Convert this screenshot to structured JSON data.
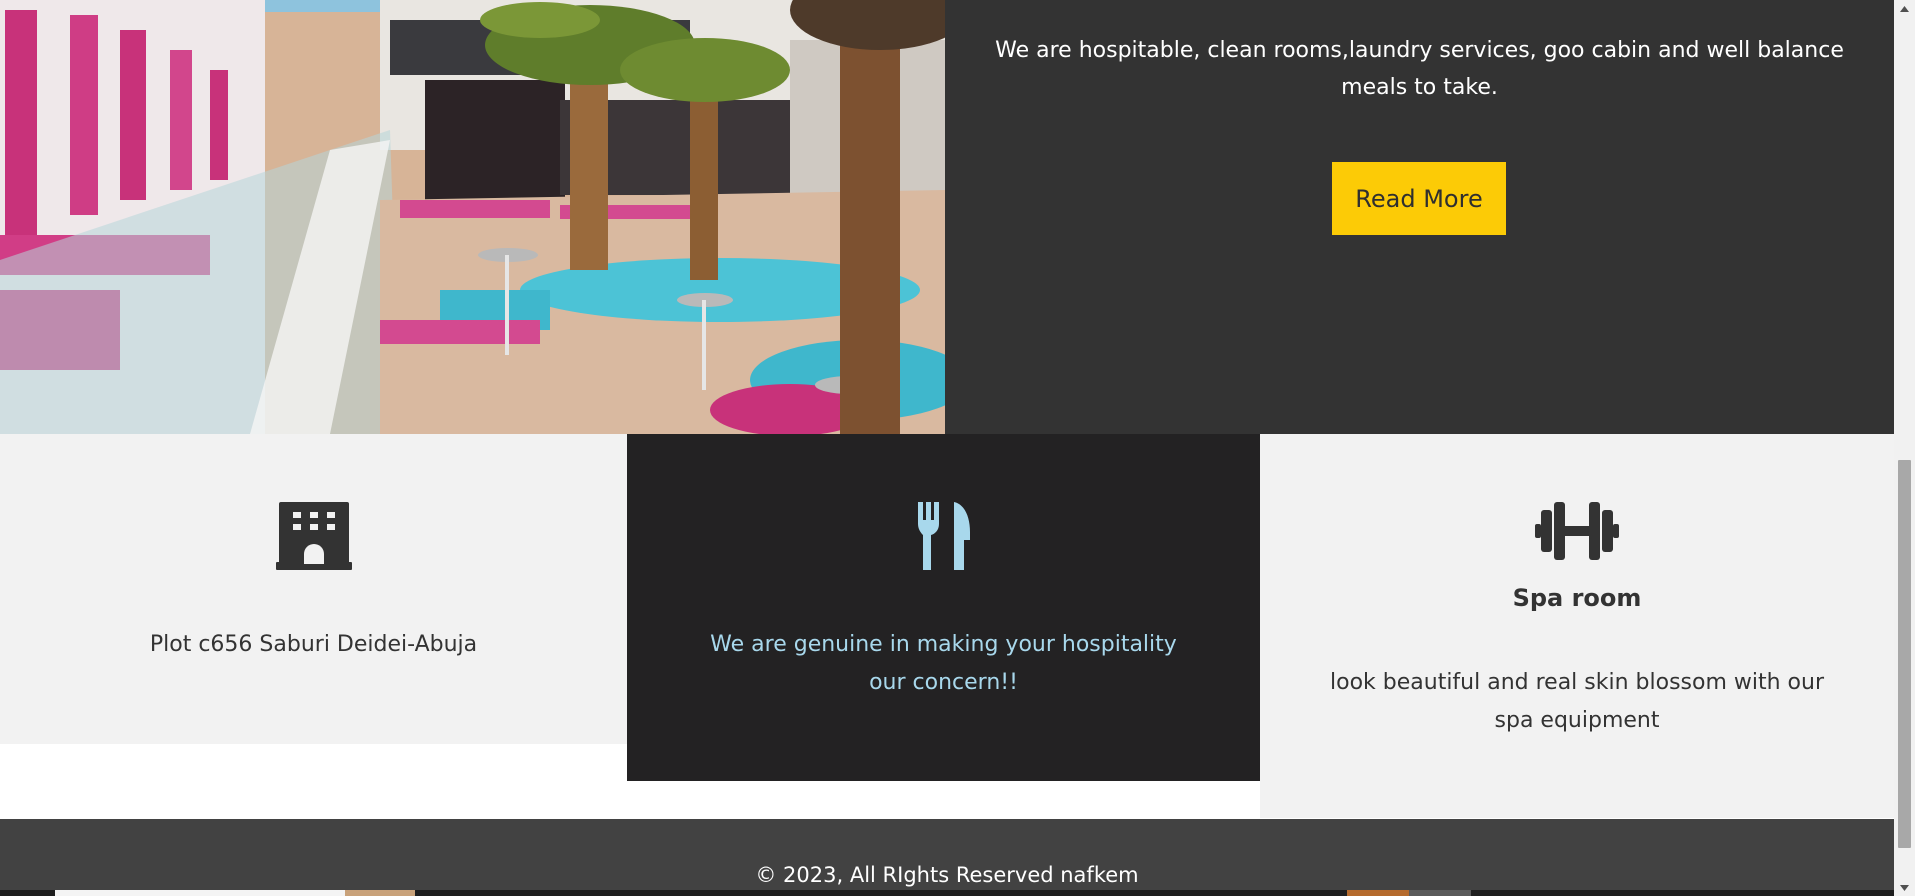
{
  "hero": {
    "image_description_name": "resort-pool-photo",
    "description": "We are hospitable, clean rooms,laundry services, goo cabin and well balance meals to take.",
    "read_more_label": "Read More"
  },
  "features": [
    {
      "icon": "hotel-building-icon",
      "title": "",
      "text": "Plot c656 Saburi Deidei-Abuja"
    },
    {
      "icon": "fork-knife-icon",
      "title": "",
      "text": "We are genuine in making your hospitality our concern!!"
    },
    {
      "icon": "dumbbell-icon",
      "title": "Spa room",
      "text": "look beautiful and real skin blossom with our spa equipment"
    }
  ],
  "footer": {
    "copyright": "© 2023, All RIghts Reserved nafkem"
  },
  "colors": {
    "accent": "#fccb06",
    "dark_panel": "#333333",
    "card_dark": "#232223",
    "card_light": "#f2f2f2",
    "highlight_text": "#a8d8ec",
    "footer": "#424242"
  }
}
